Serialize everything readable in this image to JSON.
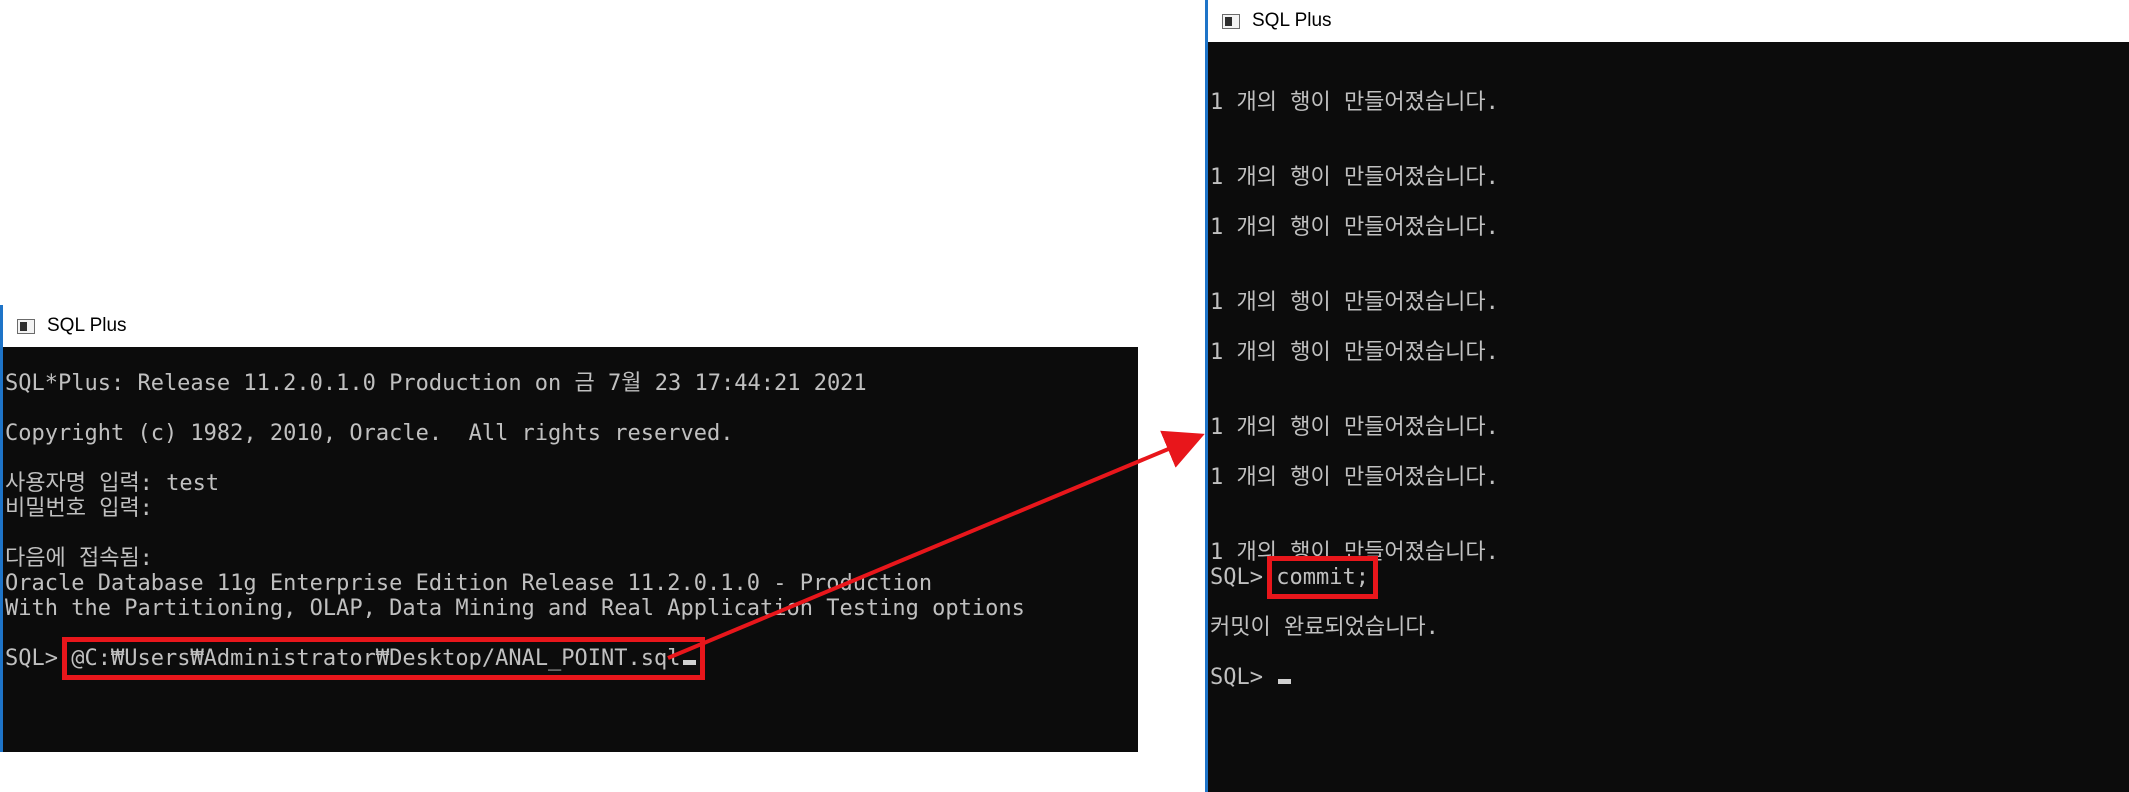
{
  "left_window": {
    "title": "SQL Plus",
    "lines": [
      "SQL*Plus: Release 11.2.0.1.0 Production on 금 7월 23 17:44:21 2021",
      "",
      "Copyright (c) 1982, 2010, Oracle.  All rights reserved.",
      "",
      "사용자명 입력: test",
      "비밀번호 입력:",
      "",
      "다음에 접속됨:",
      "Oracle Database 11g Enterprise Edition Release 11.2.0.1.0 - Production",
      "With the Partitioning, OLAP, Data Mining and Real Application Testing options",
      ""
    ],
    "prompt": "SQL> ",
    "command": "@C:₩Users₩Administrator₩Desktop/ANAL_POINT.sql"
  },
  "right_window": {
    "title": "SQL Plus",
    "row_created_message": "1 개의 행이 만들어졌습니다.",
    "prompt": "SQL> ",
    "command": "commit;",
    "commit_message": "커밋이 완료되었습니다.",
    "final_prompt": "SQL> "
  },
  "annotation": {
    "color": "#e8161b"
  }
}
